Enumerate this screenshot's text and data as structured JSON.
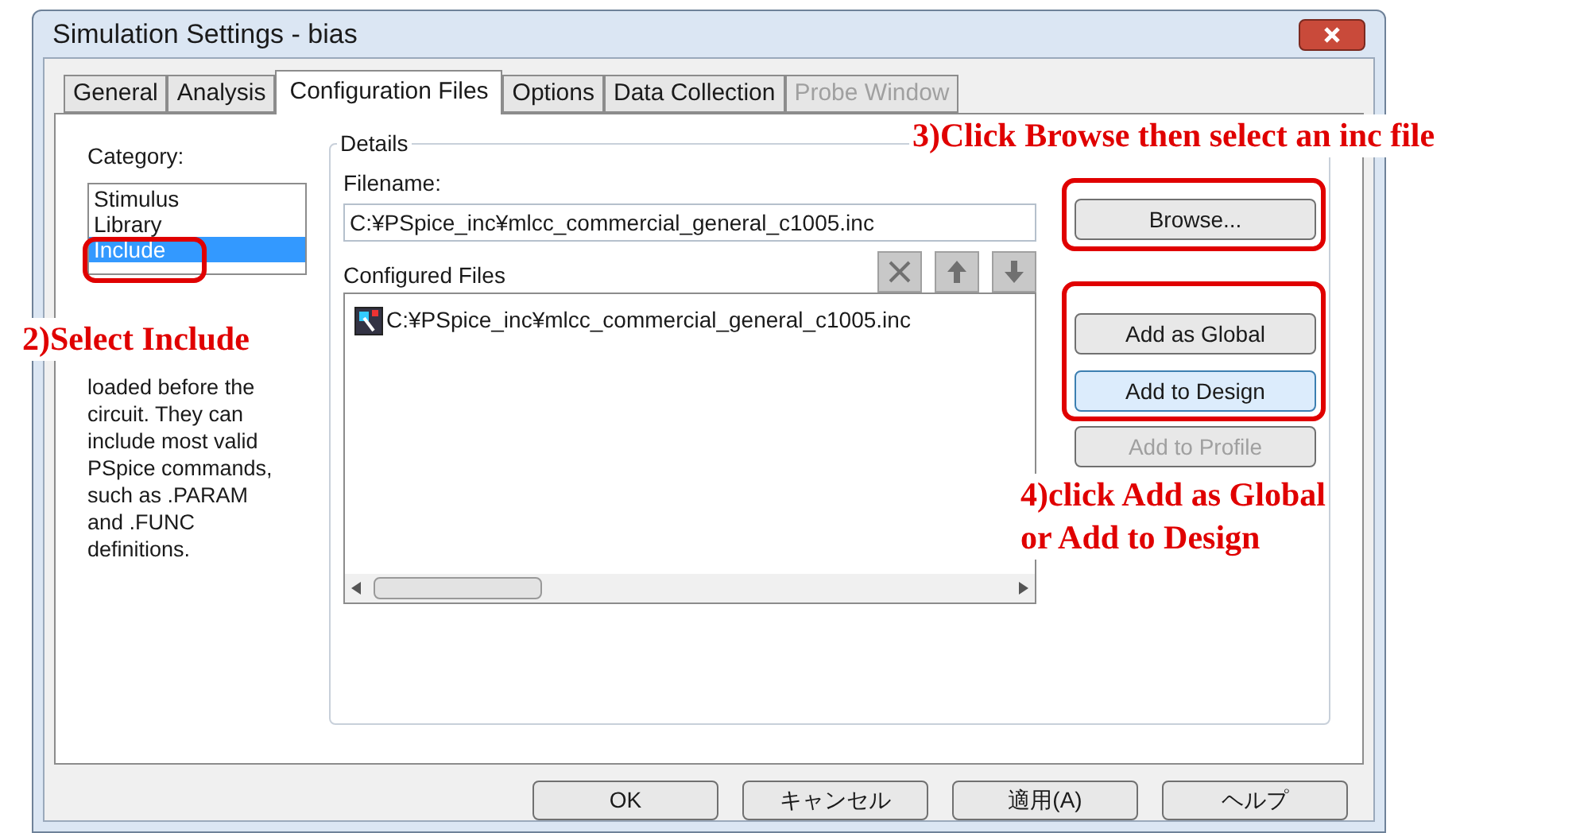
{
  "window": {
    "title": "Simulation Settings - bias"
  },
  "tabs": [
    {
      "label": "General",
      "selected": false,
      "disabled": false
    },
    {
      "label": "Analysis",
      "selected": false,
      "disabled": false
    },
    {
      "label": "Configuration Files",
      "selected": true,
      "disabled": false
    },
    {
      "label": "Options",
      "selected": false,
      "disabled": false
    },
    {
      "label": "Data Collection",
      "selected": false,
      "disabled": false
    },
    {
      "label": "Probe Window",
      "selected": false,
      "disabled": true
    }
  ],
  "category": {
    "label": "Category:",
    "items": [
      {
        "label": "Stimulus",
        "selected": false
      },
      {
        "label": "Library",
        "selected": false
      },
      {
        "label": "Include",
        "selected": true
      }
    ],
    "description": "loaded before the circuit.  They can include most valid PSpice commands, such as .PARAM and .FUNC definitions."
  },
  "details": {
    "title": "Details",
    "filename_label": "Filename:",
    "filename": "C:¥PSpice_inc¥mlcc_commercial_general_c1005.inc",
    "configured_label": "Configured Files",
    "files": [
      "C:¥PSpice_inc¥mlcc_commercial_general_c1005.inc"
    ]
  },
  "side_buttons": [
    {
      "label": "Browse...",
      "disabled": false,
      "focused": false
    },
    {
      "label": "Add as Global",
      "disabled": false,
      "focused": false
    },
    {
      "label": "Add to Design",
      "disabled": false,
      "focused": true
    },
    {
      "label": "Add to Profile",
      "disabled": true,
      "focused": false
    }
  ],
  "buttons": [
    "OK",
    "キャンセル",
    "適用(A)",
    "ヘルプ"
  ],
  "annotations": [
    "2)Select Include",
    "3)Click Browse then select an inc file",
    "4)click Add as Global\nor Add to Design"
  ]
}
